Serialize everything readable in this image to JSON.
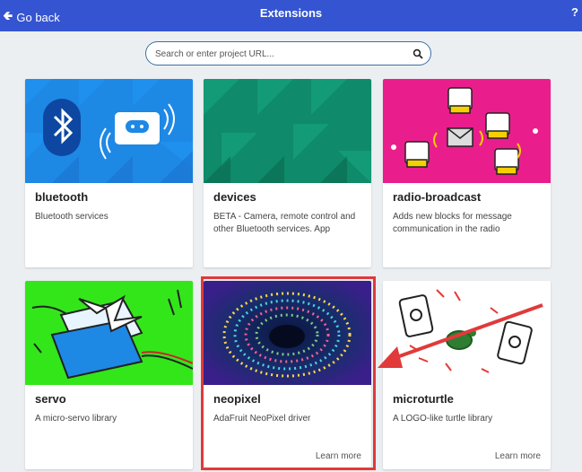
{
  "header": {
    "back_label": "Go back",
    "title": "Extensions",
    "help_label": "?"
  },
  "search": {
    "placeholder": "Search or enter project URL..."
  },
  "cards": [
    {
      "name": "bluetooth",
      "description": "Bluetooth services",
      "learn_more": ""
    },
    {
      "name": "devices",
      "description": "BETA - Camera, remote control and other Bluetooth services. App",
      "learn_more": ""
    },
    {
      "name": "radio-broadcast",
      "description": "Adds new blocks for message communication in the radio",
      "learn_more": ""
    },
    {
      "name": "servo",
      "description": "A micro-servo library",
      "learn_more": ""
    },
    {
      "name": "neopixel",
      "description": "AdaFruit NeoPixel driver",
      "learn_more": "Learn more"
    },
    {
      "name": "microturtle",
      "description": "A LOGO-like turtle library",
      "learn_more": "Learn more"
    }
  ],
  "colors": {
    "header_bg": "#3454d1",
    "bluetooth_bg": "#1e88e5",
    "devices_bg": "#0f8a6a",
    "radio_bg": "#e91e8c",
    "servo_bg": "#33e61a",
    "annotation": "#e03a3a"
  }
}
